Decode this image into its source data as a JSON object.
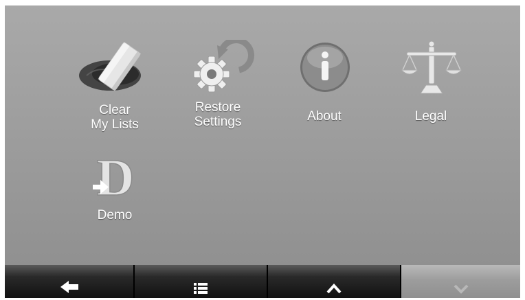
{
  "tiles": [
    {
      "label": "Clear\nMy Lists",
      "icon": "eraser-icon"
    },
    {
      "label": "Restore\nSettings",
      "icon": "restore-gear-icon"
    },
    {
      "label": "About",
      "icon": "info-icon"
    },
    {
      "label": "Legal",
      "icon": "scales-icon"
    },
    {
      "label": "Demo",
      "icon": "demo-icon"
    }
  ],
  "nav": [
    {
      "name": "back",
      "icon": "arrow-left-icon",
      "enabled": true
    },
    {
      "name": "list",
      "icon": "list-icon",
      "enabled": true
    },
    {
      "name": "scroll-up",
      "icon": "chevron-up-icon",
      "enabled": true
    },
    {
      "name": "scroll-down",
      "icon": "chevron-down-icon",
      "enabled": false
    }
  ],
  "colors": {
    "screen_background": "#a3a3a3",
    "label_text": "#ffffff",
    "nav_bar": "#151515",
    "nav_disabled": "#a0a0a0"
  }
}
